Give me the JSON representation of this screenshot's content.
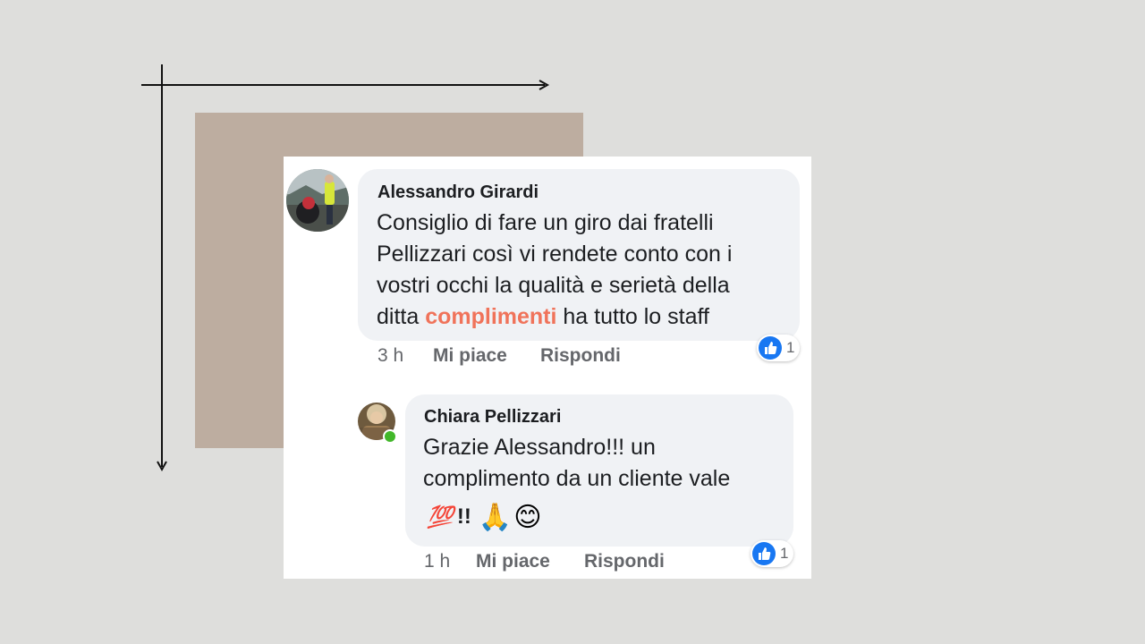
{
  "comments": [
    {
      "author": "Alessandro Girardi",
      "lines": [
        "Consiglio di fare un giro dai fratelli",
        "Pellizzari così vi rendete conto con i",
        "vostri occhi la qualità e serietà della"
      ],
      "last_line_before": "ditta ",
      "last_line_highlight": "complimenti",
      "last_line_after": " ha tutto lo staff",
      "time": "3 h",
      "like_label": "Mi piace",
      "reply_label": "Rispondi",
      "reaction_count": "1",
      "reaction_icon": "thumbs-up-icon",
      "highlight_color": "#f0735a"
    },
    {
      "author": "Chiara Pellizzari",
      "lines": [
        "Grazie Alessandro!!! un",
        "complimento da un cliente vale"
      ],
      "emoji_100": "💯",
      "exclaim": "!!",
      "emoji_pray": "🙏",
      "emoji_smile": "😊",
      "time": "1 h",
      "like_label": "Mi piace",
      "reply_label": "Rispondi",
      "reaction_count": "1",
      "reaction_icon": "thumbs-up-icon",
      "online": true
    }
  ],
  "colors": {
    "page_background": "#dededc",
    "decor_rect": "#bdada0",
    "bubble": "#f0f2f5",
    "like_blue": "#1877f2",
    "online_green": "#42b72a"
  }
}
